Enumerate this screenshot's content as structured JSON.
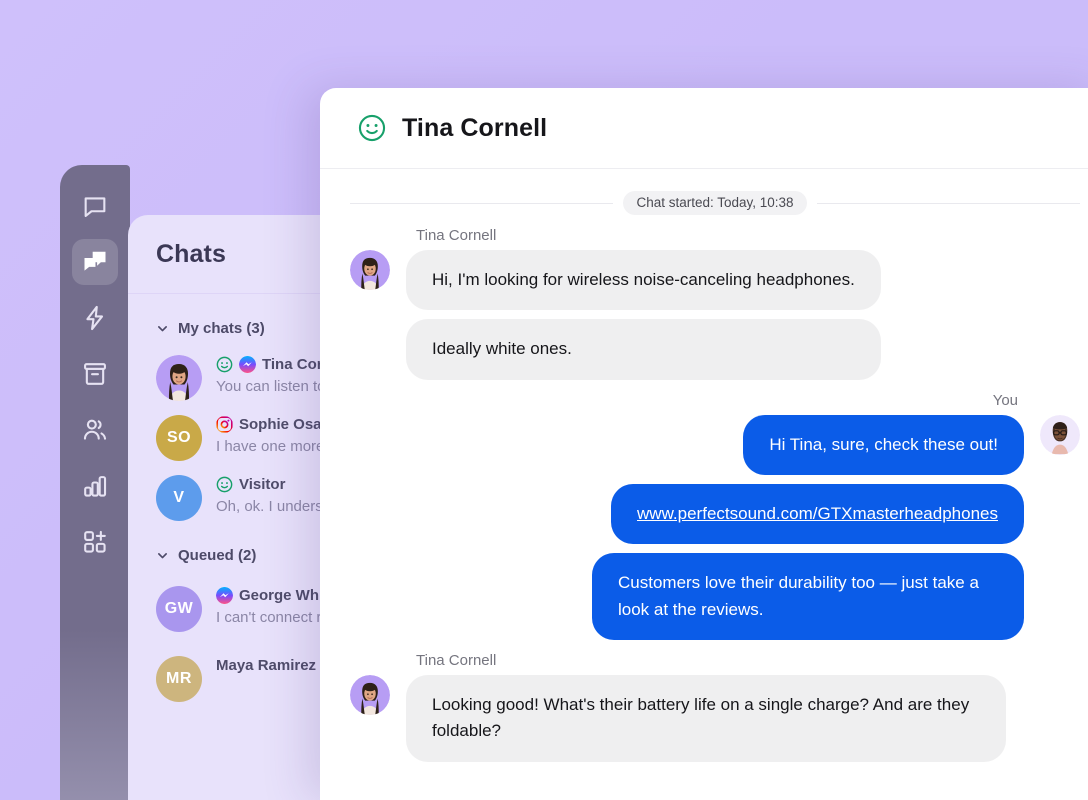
{
  "background": {
    "color": "#ccbdfa"
  },
  "theme": {
    "accent": "#0b5ce8",
    "rail": "#736d8c",
    "panel": "#e8e2fb",
    "bubble_in": "#efeff0"
  },
  "rail": {
    "items": [
      {
        "name": "logo",
        "icon": "chat-bubble-icon",
        "active": false
      },
      {
        "name": "chats",
        "icon": "chats-icon",
        "active": true
      },
      {
        "name": "automation",
        "icon": "lightning-icon",
        "active": false
      },
      {
        "name": "archives",
        "icon": "archive-icon",
        "active": false
      },
      {
        "name": "team",
        "icon": "people-icon",
        "active": false
      },
      {
        "name": "reports",
        "icon": "bar-chart-icon",
        "active": false
      },
      {
        "name": "apps",
        "icon": "apps-add-icon",
        "active": false
      }
    ]
  },
  "list": {
    "title": "Chats",
    "groups": [
      {
        "label": "My chats (3)",
        "rows": [
          {
            "name": "Tina Cornell",
            "preview": "You can listen to",
            "initials": "",
            "avatar_type": "photo",
            "avatar_bg": "#b79df4",
            "status": "smiley",
            "channel": "messenger",
            "ring": false
          },
          {
            "name": "Sophie Osaka",
            "preview": "I have one more",
            "initials": "SO",
            "avatar_type": "initials",
            "avatar_bg": "#c9a948",
            "status": "",
            "channel": "instagram",
            "ring": false
          },
          {
            "name": "Visitor",
            "preview": "Oh, ok. I underst",
            "initials": "V",
            "avatar_type": "initials",
            "avatar_bg": "#5d9cec",
            "status": "smiley",
            "channel": "",
            "ring": false
          }
        ]
      },
      {
        "label": "Queued (2)",
        "rows": [
          {
            "name": "George White",
            "preview": "I can't connect r",
            "initials": "GW",
            "avatar_type": "initials",
            "avatar_bg": "#a996ee",
            "status": "",
            "channel": "messenger",
            "ring": true
          },
          {
            "name": "Maya Ramirez",
            "preview": "",
            "initials": "MR",
            "avatar_type": "initials",
            "avatar_bg": "#cdb57e",
            "status": "",
            "channel": "",
            "ring": false
          }
        ]
      }
    ]
  },
  "chat": {
    "header": {
      "title": "Tina Cornell",
      "status_icon": "smiley-icon"
    },
    "started": "Chat started: Today, 10:38",
    "threads": [
      {
        "sender": "Tina Cornell",
        "side": "in",
        "messages": [
          "Hi, I'm looking for wireless noise-canceling headphones.",
          "Ideally white ones."
        ]
      },
      {
        "sender": "You",
        "side": "out",
        "messages": [
          "Hi Tina, sure, check these out!",
          "www.perfectsound.com/GTXmasterheadphones",
          "Customers love their durability too — just take a look at the reviews."
        ],
        "link_index": 1
      },
      {
        "sender": "Tina Cornell",
        "side": "in",
        "messages": [
          "Looking good! What's their battery life on a single charge? And are they foldable?"
        ]
      }
    ]
  }
}
